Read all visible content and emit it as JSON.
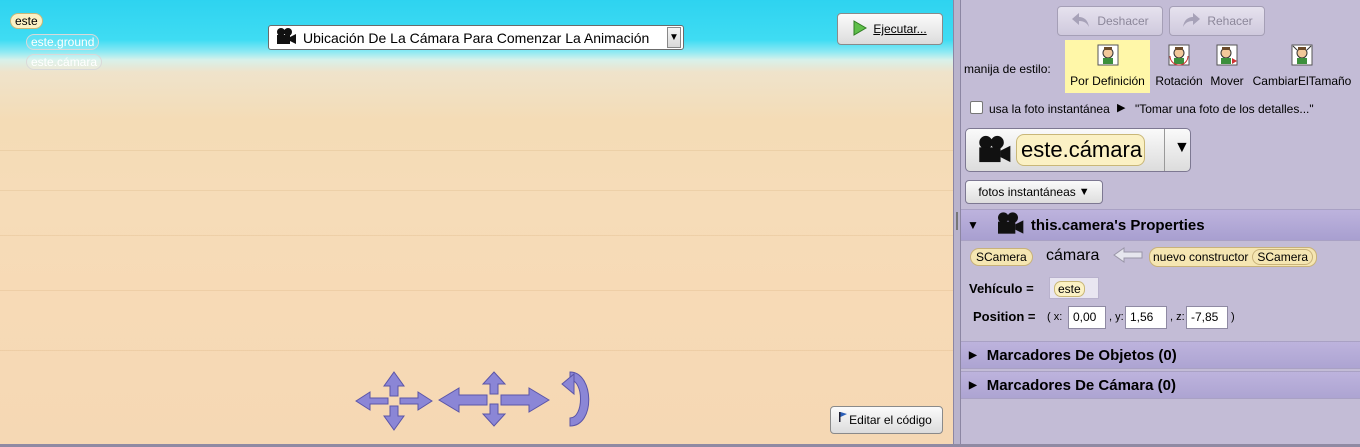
{
  "scene": {
    "tree": {
      "root": "este",
      "ground": "este.ground",
      "camera": "este.cámara"
    },
    "camera_select": {
      "label": "Ubicación De La Cámara Para Comenzar La Animación"
    },
    "run_button": "Ejecutar...",
    "edit_code_button": "Editar el código"
  },
  "panel": {
    "undo": "Deshacer",
    "redo": "Rehacer",
    "handle_style_label": "manija de estilo:",
    "handles": [
      "Por Definición",
      "Rotación",
      "Mover",
      "CambiarElTamaño"
    ],
    "snapshot_checkbox_label": "usa la foto instantánea",
    "snapshot_hint": "\"Tomar una foto de los detalles...\"",
    "selected_object": "este.cámara",
    "snapshots_button": "fotos instantáneas",
    "properties_header": "this.camera's Properties",
    "declaration": {
      "type": "SCamera",
      "name": "cámara",
      "ctor": "nuevo constructor",
      "ctor_type": "SCamera"
    },
    "vehicle_label": "Vehículo =",
    "vehicle_value": "este",
    "position_label": "Position =",
    "position": {
      "open": "( x:",
      "x": "0,00",
      "y_label": ", y:",
      "y": "1,56",
      "z_label": ", z:",
      "z": "-7,85",
      "close": ")"
    },
    "object_markers": "Marcadores De Objetos (0)",
    "camera_markers": "Marcadores De Cámara (0)"
  }
}
